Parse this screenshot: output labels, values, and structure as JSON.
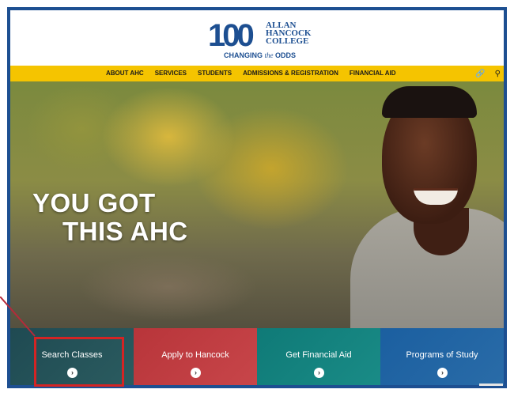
{
  "logo": {
    "number": "100",
    "name_lines": [
      "ALLAN",
      "HANCOCK",
      "COLLEGE"
    ],
    "tagline_before": "CHANGING ",
    "tagline_italic": "the",
    "tagline_after": " ODDS"
  },
  "nav": {
    "items": [
      "ABOUT AHC",
      "SERVICES",
      "STUDENTS",
      "ADMISSIONS & REGISTRATION",
      "FINANCIAL AID"
    ],
    "link_icon": "link-icon",
    "search_icon": "search-icon"
  },
  "hero": {
    "line1": "YOU GOT",
    "line2": "THIS AHC"
  },
  "tiles": [
    {
      "label": "Search Classes",
      "color": "#1f4a52"
    },
    {
      "label": "Apply to Hancock",
      "color": "#b8353a"
    },
    {
      "label": "Get Financial Aid",
      "color": "#0f7a77"
    },
    {
      "label": "Programs of Study",
      "color": "#1b5fa0"
    }
  ],
  "colors": {
    "brand_blue": "#1d4f91",
    "nav_yellow": "#f5c400",
    "highlight_red": "#d42424"
  }
}
